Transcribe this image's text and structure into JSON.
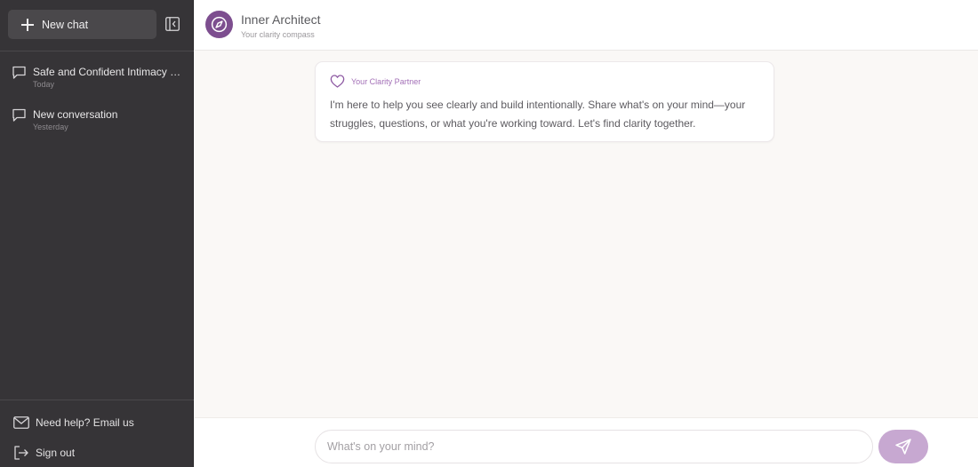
{
  "sidebar": {
    "new_chat_label": "New chat",
    "conversations": [
      {
        "title": "Safe and Confident Intimacy Planning",
        "date": "Today"
      },
      {
        "title": "New conversation",
        "date": "Yesterday"
      }
    ],
    "help_label": "Need help? Email us",
    "signout_label": "Sign out"
  },
  "header": {
    "title": "Inner Architect",
    "subtitle": "Your clarity compass",
    "logo_icon": "compass-icon"
  },
  "messages": [
    {
      "sender": "Your Clarity Partner",
      "sender_icon": "heart-icon",
      "text": "I'm here to help you see clearly and build intentionally. Share what's on your mind—your struggles, questions, or what you're working toward. Let's find clarity together."
    }
  ],
  "composer": {
    "placeholder": "What's on your mind?",
    "value": "",
    "send_icon": "send-icon"
  },
  "colors": {
    "sidebar_bg": "#363437",
    "accent": "#7d4e8f",
    "send_button": "#c7a8d1"
  }
}
